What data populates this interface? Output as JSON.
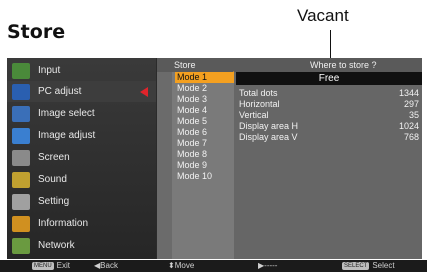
{
  "page": {
    "title": "Store",
    "callout": "Vacant"
  },
  "menu": {
    "items": [
      {
        "label": "Input",
        "icon": "input-icon",
        "color": "#4a8a3a"
      },
      {
        "label": "PC adjust",
        "icon": "pc-adjust-icon",
        "color": "#2a5fb0",
        "active": true
      },
      {
        "label": "Image select",
        "icon": "image-select-icon",
        "color": "#3a6fb8"
      },
      {
        "label": "Image adjust",
        "icon": "image-adjust-icon",
        "color": "#3a7fd0"
      },
      {
        "label": "Screen",
        "icon": "screen-icon",
        "color": "#8a8a8a"
      },
      {
        "label": "Sound",
        "icon": "sound-icon",
        "color": "#c0a030"
      },
      {
        "label": "Setting",
        "icon": "setting-icon",
        "color": "#a0a0a0"
      },
      {
        "label": "Information",
        "icon": "information-icon",
        "color": "#d09020"
      },
      {
        "label": "Network",
        "icon": "network-icon",
        "color": "#6a9a40"
      }
    ]
  },
  "panel": {
    "title": "Store",
    "question": "Where to store ?",
    "modes": [
      "Mode 1",
      "Mode 2",
      "Mode 3",
      "Mode 4",
      "Mode 5",
      "Mode 6",
      "Mode 7",
      "Mode 8",
      "Mode 9",
      "Mode 10"
    ],
    "selected_mode": "Mode 1",
    "status": "Free",
    "info": [
      {
        "label": "Total dots",
        "value": "1344"
      },
      {
        "label": "Horizontal",
        "value": "297"
      },
      {
        "label": "Vertical",
        "value": "35"
      },
      {
        "label": "Display area H",
        "value": "1024"
      },
      {
        "label": "Display area V",
        "value": "768"
      }
    ]
  },
  "footer": {
    "exit_key": "MENU",
    "exit_label": "Exit",
    "back_label": "◀Back",
    "move_label": "⬍Move",
    "next_label": "▶-----",
    "select_key": "SELECT",
    "select_label": "Select"
  },
  "colors": {
    "accent": "#f4a020",
    "pointer": "#e0242b"
  }
}
